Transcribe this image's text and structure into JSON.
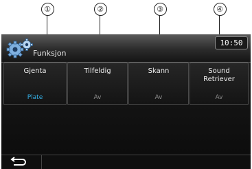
{
  "callouts": [
    "①",
    "②",
    "③",
    "④"
  ],
  "header": {
    "title": "Funksjon",
    "clock": "10:50",
    "icon": "gear-icon"
  },
  "options": [
    {
      "label": "Gjenta",
      "value": "Plate",
      "active": true
    },
    {
      "label": "Tilfeldig",
      "value": "Av",
      "active": false
    },
    {
      "label": "Skann",
      "value": "Av",
      "active": false
    },
    {
      "label": "Sound\nRetriever",
      "value": "Av",
      "active": false
    }
  ],
  "footer": {
    "back_icon": "back-arrow-icon"
  },
  "colors": {
    "active_value": "#35b2ea",
    "inactive_value": "#8d8d8d"
  }
}
